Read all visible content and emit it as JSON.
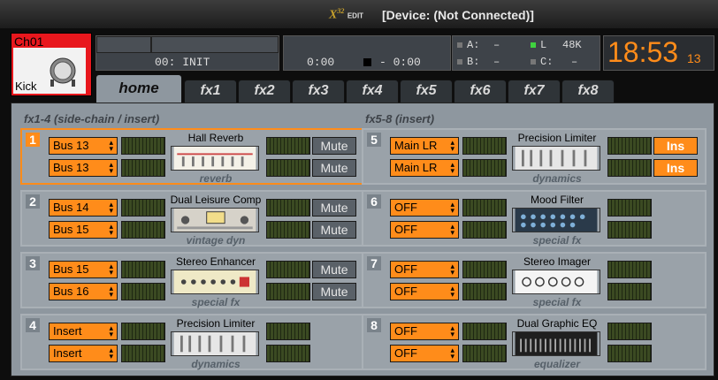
{
  "title": {
    "logo": "X",
    "logo_sup": "32",
    "logo_small": "EDIT",
    "device": "[Device: (Not Connected)]"
  },
  "channel": {
    "id": "Ch01",
    "name": "Kick"
  },
  "scene": {
    "label": "00: INIT"
  },
  "transport": {
    "time_a": "0:00",
    "time_b": "- 0:00"
  },
  "buses": {
    "a_label": "A:",
    "a_value": "–",
    "b_label": "B:",
    "b_value": "–",
    "l_label": "L",
    "l_value": "48K",
    "c_label": "C:",
    "c_value": "–"
  },
  "clock": {
    "time": "18:53",
    "seconds": "13"
  },
  "tabs": [
    "home",
    "fx1",
    "fx2",
    "fx3",
    "fx4",
    "fx5",
    "fx6",
    "fx7",
    "fx8"
  ],
  "sections": {
    "left": "fx1-4 (side-chain / insert)",
    "right": "fx5-8 (insert)"
  },
  "slots": [
    {
      "num": "1",
      "src1": "Bus 13",
      "src2": "Bus 13",
      "name": "Hall Reverb",
      "category": "reverb",
      "button": "Mute"
    },
    {
      "num": "2",
      "src1": "Bus 14",
      "src2": "Bus 15",
      "name": "Dual Leisure Comp",
      "category": "vintage dyn",
      "button": "Mute"
    },
    {
      "num": "3",
      "src1": "Bus 15",
      "src2": "Bus 16",
      "name": "Stereo Enhancer",
      "category": "special fx",
      "button": "Mute"
    },
    {
      "num": "4",
      "src1": "Insert",
      "src2": "Insert",
      "name": "Precision Limiter",
      "category": "dynamics",
      "button": ""
    },
    {
      "num": "5",
      "src1": "Main LR",
      "src2": "Main LR",
      "name": "Precision Limiter",
      "category": "dynamics",
      "button": "Ins"
    },
    {
      "num": "6",
      "src1": "OFF",
      "src2": "OFF",
      "name": "Mood Filter",
      "category": "special fx",
      "button": ""
    },
    {
      "num": "7",
      "src1": "OFF",
      "src2": "OFF",
      "name": "Stereo Imager",
      "category": "special fx",
      "button": ""
    },
    {
      "num": "8",
      "src1": "OFF",
      "src2": "OFF",
      "name": "Dual Graphic EQ",
      "category": "equalizer",
      "button": ""
    }
  ],
  "colors": {
    "accent": "#ff8c1a",
    "panel": "#8e979f",
    "meter": "#3b4a22"
  }
}
